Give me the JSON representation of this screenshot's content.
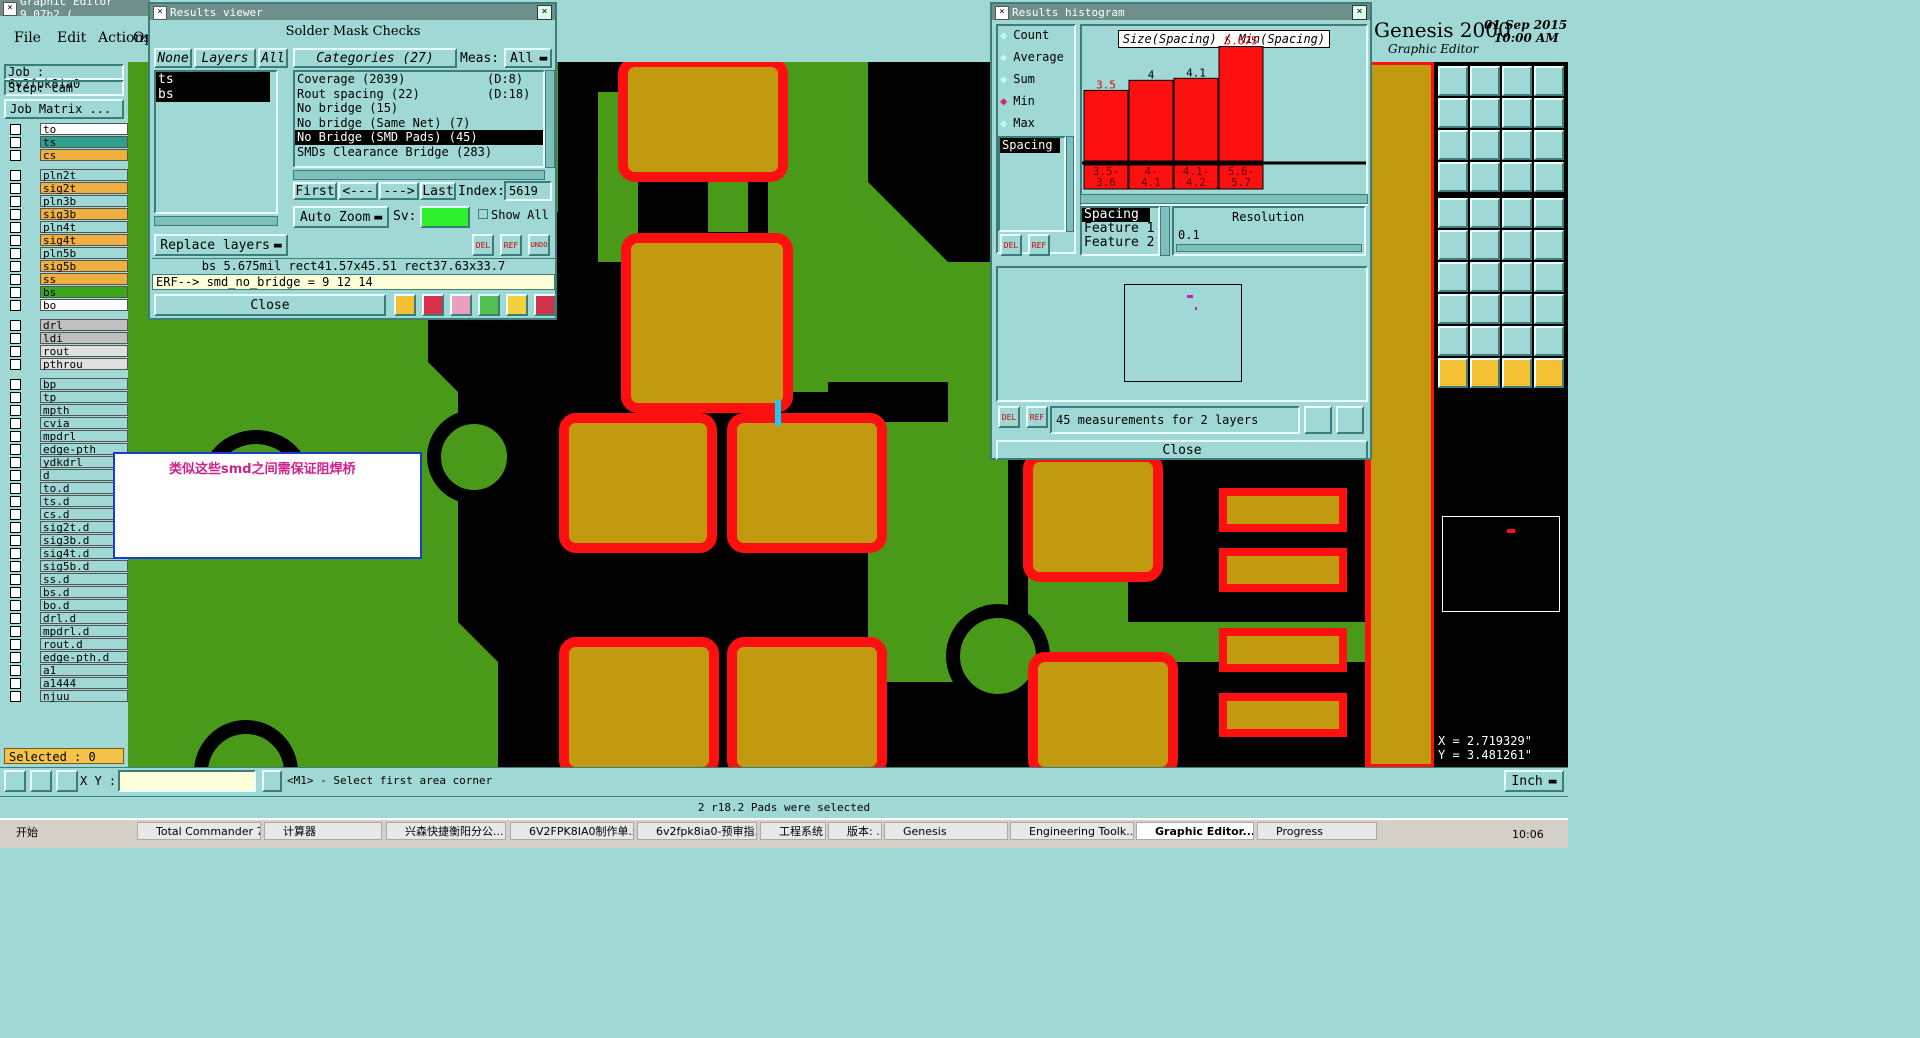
{
  "app": {
    "title": "Graphic Editor 9.07b2 (",
    "menu": [
      "File",
      "Edit",
      "Actions",
      "Op"
    ],
    "job_label": "Job : 6v2fpk8ia0",
    "step_label": "Step: cam",
    "job_matrix": "Job Matrix ...",
    "brand": "Genesis 2000",
    "brand_sub": "Graphic Editor",
    "date": "01 Sep 2015",
    "time": "10:00 AM"
  },
  "layers": [
    {
      "name": "to",
      "color": "#ffffff"
    },
    {
      "name": "ts",
      "color": "#2f9f8f"
    },
    {
      "name": "cs",
      "color": "#f0b040"
    },
    {
      "name": "pln2t",
      "color": "#9fd8d4"
    },
    {
      "name": "sig2t",
      "color": "#f0b040"
    },
    {
      "name": "pln3b",
      "color": "#9fd8d4"
    },
    {
      "name": "sig3b",
      "color": "#f0b040"
    },
    {
      "name": "pln4t",
      "color": "#9fd8d4"
    },
    {
      "name": "sig4t",
      "color": "#f0b040"
    },
    {
      "name": "pln5b",
      "color": "#9fd8d4"
    },
    {
      "name": "sig5b",
      "color": "#f0b040"
    },
    {
      "name": "ss",
      "color": "#f0b040"
    },
    {
      "name": "bs",
      "color": "#3aa81a"
    },
    {
      "name": "bo",
      "color": "#ffffff"
    },
    {
      "name": "drl",
      "color": "#bfbfbf"
    },
    {
      "name": "ldi",
      "color": "#bfbfbf"
    },
    {
      "name": "rout",
      "color": "#e0e0e0"
    },
    {
      "name": "pthrou",
      "color": "#e0e0e0"
    },
    {
      "name": "bp",
      "color": "#9fd8d4"
    },
    {
      "name": "tp",
      "color": "#9fd8d4"
    },
    {
      "name": "mpth",
      "color": "#9fd8d4"
    },
    {
      "name": "cvia",
      "color": "#9fd8d4"
    },
    {
      "name": "mpdrl",
      "color": "#9fd8d4"
    },
    {
      "name": "edge-pth",
      "color": "#9fd8d4"
    },
    {
      "name": "ydkdrl",
      "color": "#9fd8d4"
    },
    {
      "name": "d",
      "color": "#9fd8d4"
    },
    {
      "name": "to.d",
      "color": "#9fd8d4"
    },
    {
      "name": "ts.d",
      "color": "#9fd8d4"
    },
    {
      "name": "cs.d",
      "color": "#9fd8d4"
    },
    {
      "name": "sig2t.d",
      "color": "#9fd8d4"
    },
    {
      "name": "sig3b.d",
      "color": "#9fd8d4"
    },
    {
      "name": "sig4t.d",
      "color": "#9fd8d4"
    },
    {
      "name": "sig5b.d",
      "color": "#9fd8d4"
    },
    {
      "name": "ss.d",
      "color": "#9fd8d4"
    },
    {
      "name": "bs.d",
      "color": "#9fd8d4"
    },
    {
      "name": "bo.d",
      "color": "#9fd8d4"
    },
    {
      "name": "drl.d",
      "color": "#9fd8d4"
    },
    {
      "name": "mpdrl.d",
      "color": "#9fd8d4"
    },
    {
      "name": "rout.d",
      "color": "#9fd8d4"
    },
    {
      "name": "edge-pth.d",
      "color": "#9fd8d4"
    },
    {
      "name": "a1",
      "color": "#9fd8d4"
    },
    {
      "name": "a1444",
      "color": "#9fd8d4"
    },
    {
      "name": "njuu",
      "color": "#9fd8d4"
    }
  ],
  "selected_count": "Selected : 0",
  "results_viewer": {
    "title": "Results viewer",
    "header": "Solder Mask Checks",
    "btn_none": "None",
    "btn_layers": "Layers",
    "btn_all": "All",
    "categories_label": "Categories (27)",
    "meas_label": "Meas:",
    "meas_value": "All",
    "layer_list": [
      "ts",
      "bs"
    ],
    "categories": [
      {
        "name": "Coverage (2039)",
        "code": "(D:8)"
      },
      {
        "name": "Rout spacing (22)",
        "code": "(D:18)"
      },
      {
        "name": "No bridge (15)",
        "code": ""
      },
      {
        "name": "No bridge (Same Net) (7)",
        "code": ""
      },
      {
        "name": "No Bridge (SMD Pads) (45)",
        "code": ""
      },
      {
        "name": "SMDs Clearance Bridge (283)",
        "code": ""
      }
    ],
    "nav": {
      "first": "First",
      "prev": "<---",
      "next": "--->",
      "last": "Last",
      "index_label": "Index:",
      "index_value": "5619"
    },
    "auto_zoom": "Auto Zoom",
    "sv_label": "Sv:",
    "show_all": "Show All",
    "replace_layers": "Replace layers",
    "del": "DEL",
    "ref": "REF",
    "undo": "UNDO",
    "measure_line": "bs 5.675mil   rect41.57x45.51   rect37.63x33.7",
    "erf_line": "ERF--> smd_no_bridge = 9 12 14",
    "close": "Close"
  },
  "histogram": {
    "title": "Results histogram",
    "options": [
      "Count",
      "Average",
      "Sum",
      "Min",
      "Max"
    ],
    "selected_option": "Min",
    "chart_title": "Size(Spacing) / Min(Spacing)",
    "list_label": "Spacing",
    "feature_list": [
      "Spacing",
      "Feature 1",
      "Feature 2"
    ],
    "resolution_label": "Resolution",
    "resolution_value": "0.1",
    "measure_status": "45 measurements for 2 layers",
    "del": "DEL",
    "ref": "REF",
    "close": "Close"
  },
  "chart_data": {
    "type": "bar",
    "title": "Size(Spacing) / Min(Spacing)",
    "categories": [
      "3.5-3.6",
      "4-4.1",
      "4.1-4.2",
      "5.6-5.7"
    ],
    "values": [
      3.5,
      4,
      4.1,
      5.675
    ],
    "value_labels": [
      "3.5",
      "4",
      "4.1",
      "5.675"
    ],
    "ylim": [
      0,
      6
    ],
    "bar_color": "#ff1010"
  },
  "annotation": {
    "text": "类似这些smd之间需保证阻焊桥"
  },
  "coords": {
    "x": "X = 2.719329\"",
    "y": "Y = 3.481261\""
  },
  "bottom": {
    "xy_label": "X Y :",
    "prompt": "<M1> - Select first area corner",
    "unit": "Inch",
    "status": "2 r18.2 Pads were selected"
  },
  "taskbar": {
    "start": "开始",
    "items": [
      "Total Commander 7...",
      "计算器",
      "兴森快捷衡阳分公...",
      "6V2FPK8IA0制作单.xls",
      "6v2fpk8ia0-预审指...",
      "工程系统",
      "版本: ...",
      "Genesis",
      "Engineering Toolk...",
      "Graphic Editor...",
      "Progress"
    ],
    "clock": "10:06"
  },
  "colors": {
    "teal": "#9fd8d4",
    "green": "#4a9a1a",
    "pad": "#c29a10",
    "red": "#ff1010",
    "black": "#000000"
  }
}
